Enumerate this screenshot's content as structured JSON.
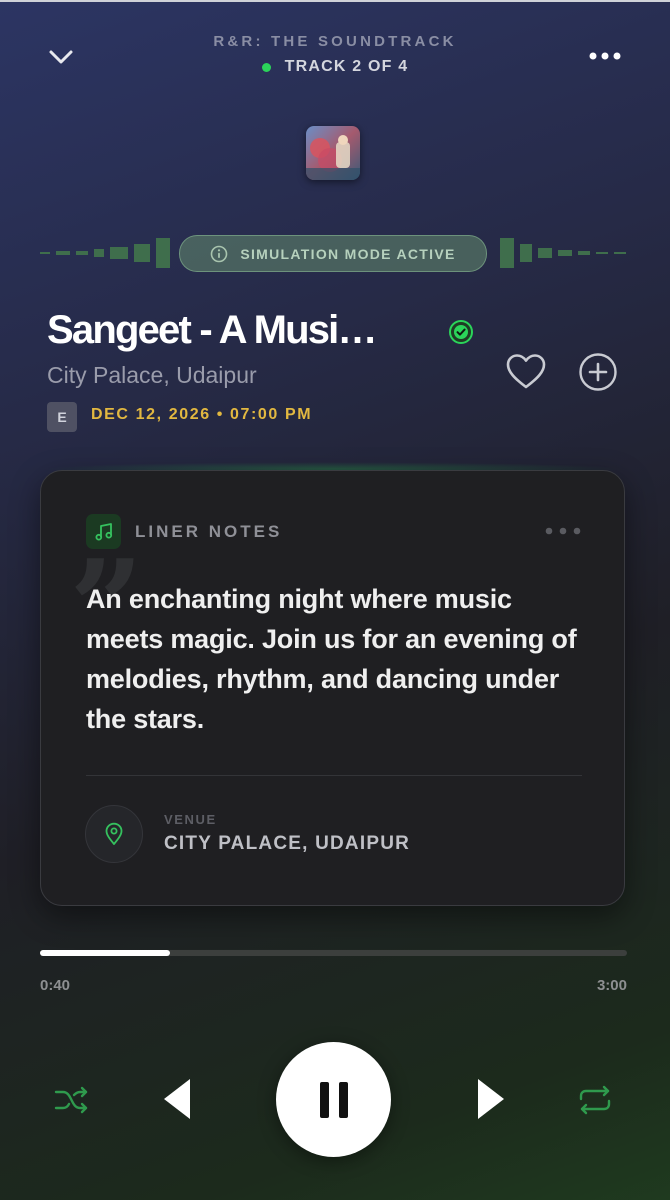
{
  "header": {
    "album_name": "R&R: THE SOUNDTRACK",
    "track_position": "TRACK 2 OF 4",
    "collapse_icon": "chevron-down-icon",
    "more_icon": "more-horizontal-icon"
  },
  "badge": {
    "label": "SIMULATION MODE ACTIVE",
    "icon": "info-icon"
  },
  "event": {
    "title": "Sangeet - A Musi…",
    "location": "City Palace, Udaipur",
    "explicit_label": "E",
    "date_time": "DEC 12, 2026 • 07:00 PM"
  },
  "liner_notes": {
    "heading": "LINER NOTES",
    "description": "An enchanting night where music meets magic. Join us for an evening of melodies, rhythm, and dancing under the stars.",
    "venue_label": "VENUE",
    "venue_value": "CITY PALACE, UDAIPUR"
  },
  "playback": {
    "current_time": "0:40",
    "total_time": "3:00",
    "progress_fraction": 0.222
  },
  "colors": {
    "accent_green": "#2bd45a",
    "date_gold": "#e2b840"
  }
}
